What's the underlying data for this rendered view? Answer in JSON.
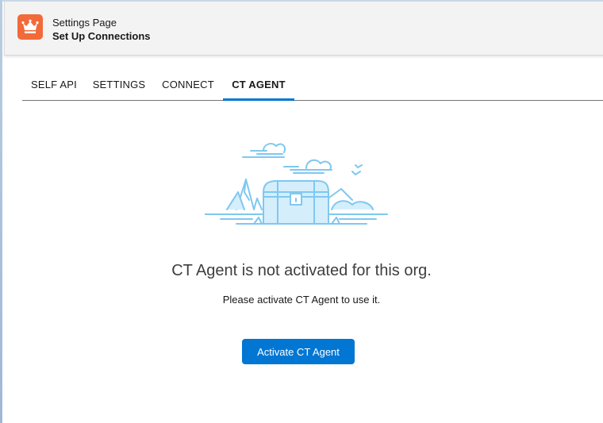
{
  "header": {
    "subtitle": "Settings Page",
    "title": "Set Up Connections",
    "icon": "crown-icon",
    "accent": "#f26a3a"
  },
  "tabs": [
    {
      "label": "SELF API",
      "active": false
    },
    {
      "label": "SETTINGS",
      "active": false
    },
    {
      "label": "CONNECT",
      "active": false
    },
    {
      "label": "CT AGENT",
      "active": true
    }
  ],
  "empty_state": {
    "illustration": "treasure-chest-icon",
    "title": "CT Agent is not activated for this org.",
    "message": "Please activate CT Agent to use it.",
    "button_label": "Activate CT Agent"
  },
  "colors": {
    "primary": "#0176d3",
    "illustration": "#7fc8f0"
  }
}
